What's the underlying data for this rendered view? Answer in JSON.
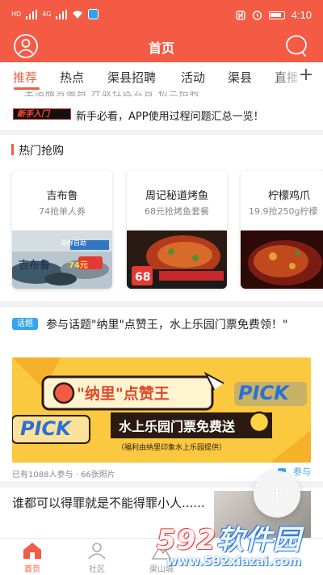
{
  "status_bar": {
    "carrier_1": "HD",
    "carrier_2": "HD",
    "network": "4G",
    "time": "4:10"
  },
  "header": {
    "title": "首页",
    "avatar_icon": "user-avatar-icon",
    "message_icon": "chat-bubble-icon"
  },
  "tabs": {
    "items": [
      "推荐",
      "热点",
      "渠县招聘",
      "活动",
      "渠县",
      "直播"
    ],
    "active_index": 0,
    "add_label": "+"
  },
  "notice": {
    "cut_text": "生活服务缴费     开放社区公告     初三招聘",
    "badge": "新手入门",
    "text": "新手必看，APP使用过程问题汇总一览！"
  },
  "hot": {
    "title": "热门抢购",
    "cards": [
      {
        "name": "吉布鲁",
        "sub": "74抢单人券",
        "image_text": "吉布鲁",
        "image_badge": "74元",
        "image_tag": "海鲜自助"
      },
      {
        "name": "周记秘道烤鱼",
        "sub": "68元抢烤鱼套餐",
        "image_text": "68",
        "image_badge": "",
        "image_tag": ""
      },
      {
        "name": "柠檬鸡爪",
        "sub": "19.9抢250g柠檬",
        "image_text": "",
        "image_badge": "",
        "image_tag": ""
      }
    ]
  },
  "post": {
    "tag": "话题",
    "title": "参与话题\"纳里\"点赞王，水上乐园门票免费领！\"",
    "banner_headline": "\"纳里\"点赞王",
    "banner_pick": "PICK",
    "banner_sub": "水上乐园门票免费送",
    "banner_note": "（福利由纳里印象水上乐园提供）",
    "meta": "已有1088人参与 · 66张照片",
    "join_label": "参与"
  },
  "post2": {
    "text": "谁都可以得罪就是不能得罪小人......"
  },
  "fab": {
    "label": "+"
  },
  "bottom_nav": {
    "items": [
      {
        "label": "首页",
        "icon": "home-icon"
      },
      {
        "label": "社区",
        "icon": "community-icon"
      },
      {
        "label": "渠山城",
        "icon": "mountain-city-icon"
      }
    ],
    "active_index": 0
  },
  "watermark": {
    "brand_num": "592",
    "brand_text": "软件园",
    "url": "www.592xiazai.com"
  },
  "colors": {
    "primary": "#f35b44",
    "topic": "#36a4f0",
    "banner": "#fbc93f"
  }
}
